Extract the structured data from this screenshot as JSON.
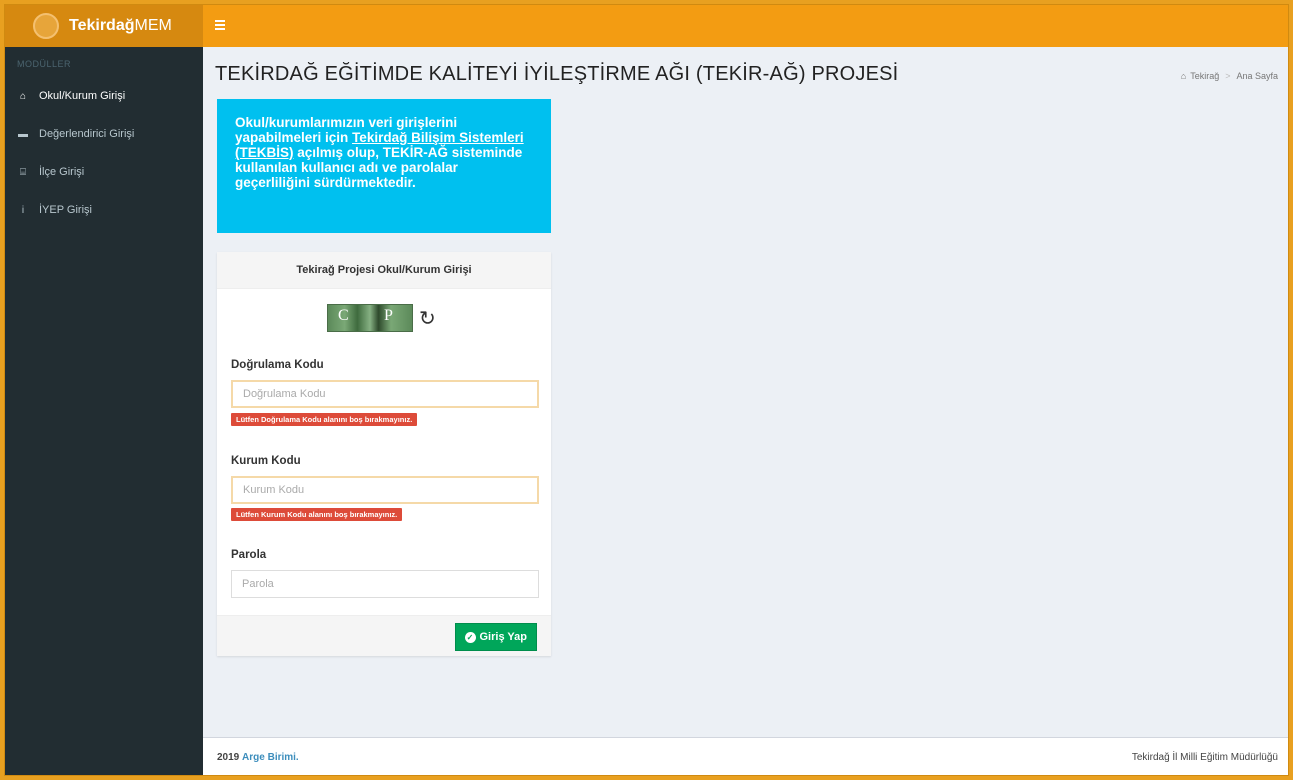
{
  "header": {
    "logo_bold": "Tekirdağ",
    "logo_light": "MEM"
  },
  "sidebar": {
    "heading": "MODÜLLER",
    "items": [
      {
        "icon": "home-icon",
        "label": "Okul/Kurum Girişi",
        "active": true
      },
      {
        "icon": "id-card-icon",
        "label": "Değerlendirici Girişi",
        "active": false
      },
      {
        "icon": "institution-icon",
        "label": "İlçe Girişi",
        "active": false
      },
      {
        "icon": "info-icon",
        "label": "İYEP Girişi",
        "active": false
      }
    ]
  },
  "main": {
    "title": "TEKİRDAĞ EĞİTİMDE KALİTEYİ İYİLEŞTİRME AĞI (TEKİR-AĞ) PROJESİ",
    "breadcrumb": [
      "Tekirağ",
      "Ana Sayfa"
    ],
    "info": {
      "part1": "Okul/kurumlarımızın veri girişlerini yapabilmeleri için ",
      "link": "Tekirdağ Bilişim Sistemleri (TEKBİS)",
      "part2": " açılmış olup, TEKİR-AĞ sisteminde kullanılan kullanıcı adı ve parolalar geçerliliğini sürdürmektedir."
    },
    "login": {
      "heading": "Tekirağ Projesi Okul/Kurum Girişi",
      "captcha_chars": [
        "C",
        "P"
      ],
      "code_label": "Doğrulama Kodu",
      "code_placeholder": "Doğrulama Kodu",
      "code_error": "Lütfen Doğrulama Kodu alanını boş bırakmayınız.",
      "inst_label": "Kurum Kodu",
      "inst_placeholder": "Kurum Kodu",
      "inst_error": "Lütfen Kurum Kodu alanını boş bırakmayınız.",
      "pass_label": "Parola",
      "pass_placeholder": "Parola",
      "submit_label": "Giriş Yap"
    }
  },
  "footer": {
    "year": "2019",
    "link": "Arge Birimi.",
    "right": "Tekirdağ İl Milli Eğitim Müdürlüğü"
  },
  "colors": {
    "header": "#f39c12",
    "sidebar": "#222d32",
    "info": "#00c0ef",
    "success": "#00a65a",
    "danger": "#dd4b39"
  }
}
